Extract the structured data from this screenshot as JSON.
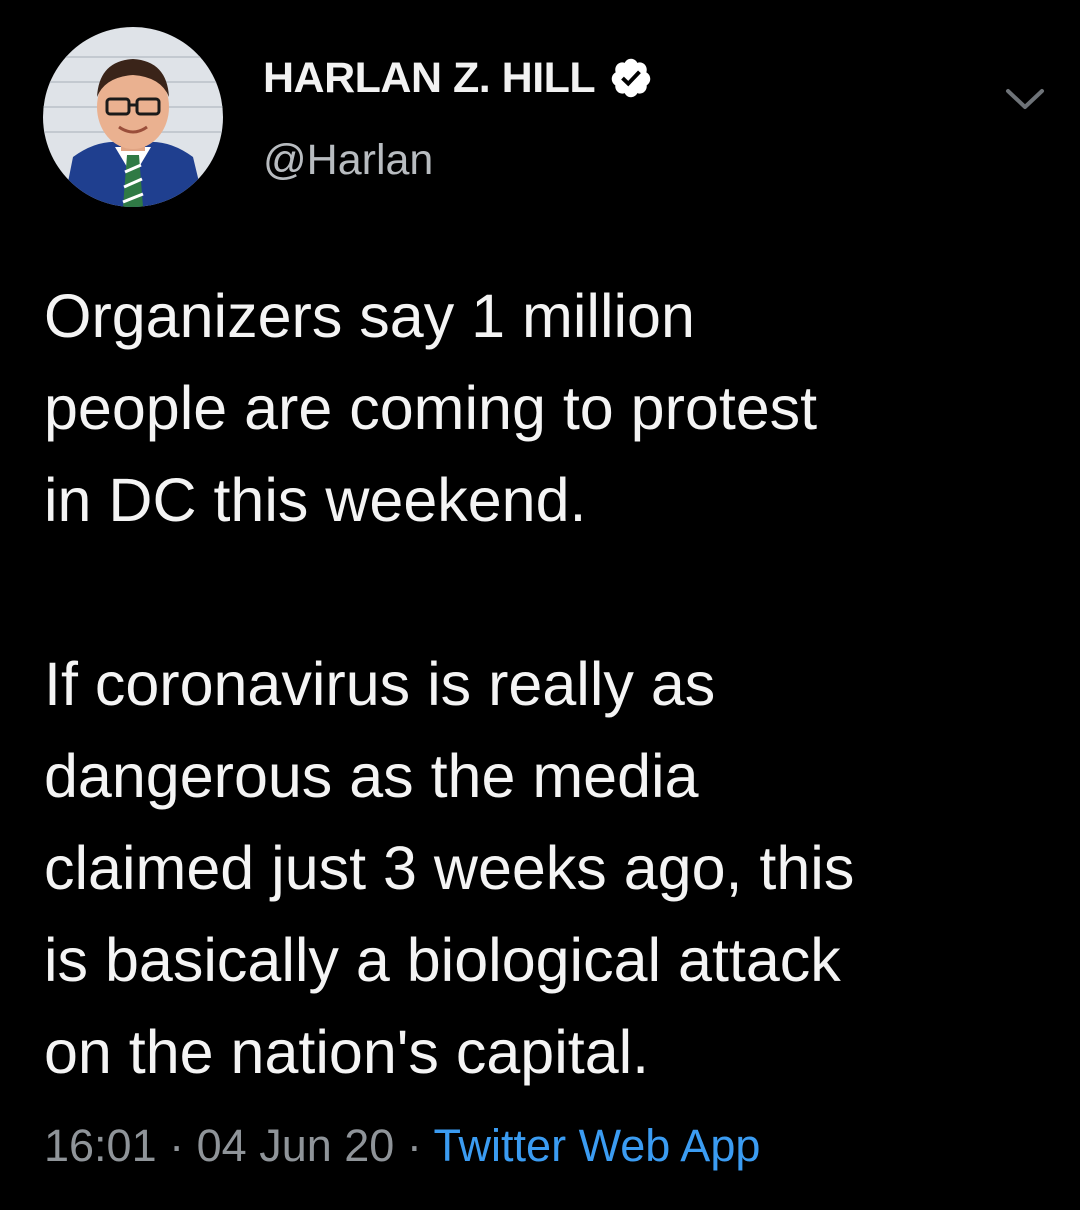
{
  "tweet": {
    "author": {
      "display_name": "HARLAN Z. HILL",
      "handle": "@Harlan",
      "verified": true,
      "avatar_icon": "profile-photo"
    },
    "text": {
      "paragraph1": "Organizers say 1 million\npeople are coming to protest\nin DC this weekend.",
      "paragraph2": "If coronavirus is really as\ndangerous as the media\nclaimed just 3 weeks ago, this\nis basically a biological attack\non the nation's capital."
    },
    "meta": {
      "time": "16:01",
      "separator": "·",
      "date": "04 Jun 20",
      "source": "Twitter Web App"
    },
    "menu_icon": "chevron-down-icon"
  },
  "colors": {
    "background": "#000000",
    "text": "#f4f4f4",
    "muted": "#8f9499",
    "link": "#3b9cf2"
  }
}
